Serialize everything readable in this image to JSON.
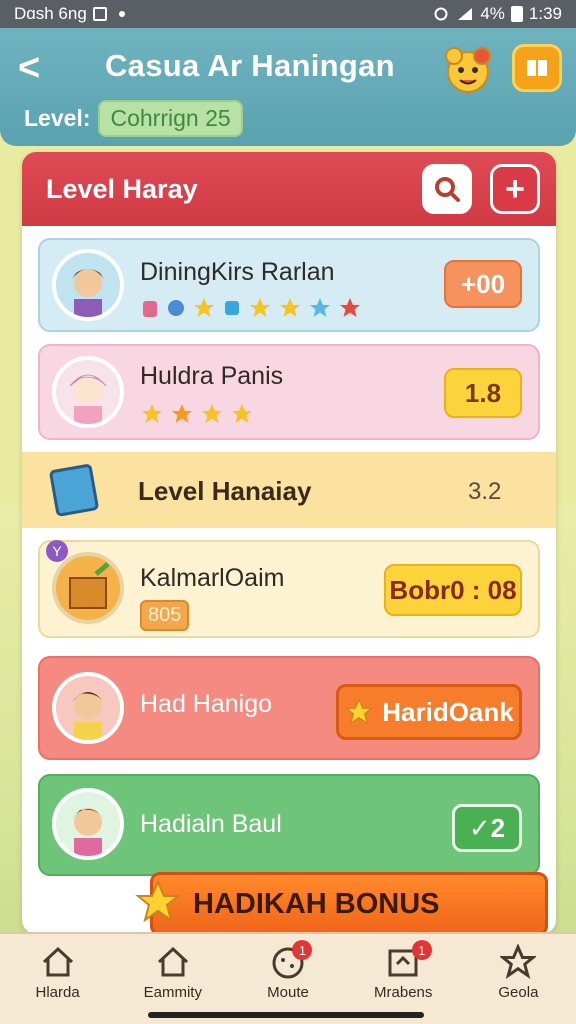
{
  "status_bar": {
    "left_text": "Dɑsh 6ng",
    "battery": "4%",
    "time": "1:39"
  },
  "header": {
    "back_glyph": "<",
    "title": "Casua Ar Haningan",
    "level_label": "Level:",
    "level_value": "Cohrrign 25"
  },
  "panel": {
    "title": "Level Haray",
    "add_glyph": "+",
    "cards": [
      {
        "name": "DiningKirs Rarlan",
        "score": "+00"
      },
      {
        "name": "Huldra Panis",
        "score": "1.8"
      }
    ],
    "band": {
      "title": "Level Hanaiay",
      "value": "3.2"
    },
    "card3": {
      "name": "KalmarlOaim",
      "badge": "805",
      "mini": "Y",
      "score": "Bobr0 : 08"
    },
    "card4": {
      "name": "Had Hanigo",
      "score": "HaridOank"
    },
    "card5": {
      "name": "Hadialn Baul",
      "score": "✓2"
    }
  },
  "bonus": {
    "label": "HADIKAH BONUS"
  },
  "tabbar": {
    "tabs": [
      {
        "label": "Hlarda",
        "icon": "home-icon"
      },
      {
        "label": "Eammity",
        "icon": "house-icon"
      },
      {
        "label": "Moute",
        "icon": "cookie-icon",
        "badge": "1"
      },
      {
        "label": "Mrabens",
        "icon": "calendar-icon",
        "badge": "1"
      },
      {
        "label": "Geola",
        "icon": "star-icon"
      }
    ]
  },
  "colors": {
    "header": "#5aa2b0",
    "panel_head": "#e04a55",
    "bonus": "#f1651a",
    "accent_yellow": "#fbd33a"
  }
}
